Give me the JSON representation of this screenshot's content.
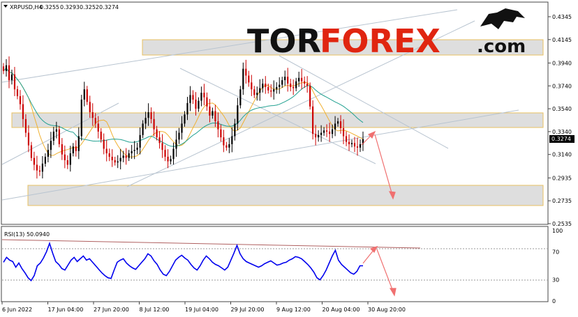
{
  "chart_data": [
    {
      "type": "candlestick",
      "symbol": "XRPUSD,H4",
      "ohlc": [
        "0.3255",
        "0.3293",
        "0.3252",
        "0.3274"
      ],
      "current_price": "0.3274",
      "price_ticks": [
        "0.4345",
        "0.4145",
        "0.3940",
        "0.3740",
        "0.3540",
        "0.3340",
        "0.3140",
        "0.2935",
        "0.2735",
        "0.2535"
      ],
      "ylim": [
        0.2535,
        0.4345
      ],
      "x_ticks": [
        "6 Jun 2022",
        "17 Jun 04:00",
        "27 Jun 20:00",
        "8 Jul 12:00",
        "19 Jul 04:00",
        "29 Jul 20:00",
        "9 Aug 12:00",
        "20 Aug 04:00",
        "30 Aug 20:00"
      ],
      "close_series": [
        0.387,
        0.392,
        0.379,
        0.384,
        0.371,
        0.365,
        0.358,
        0.345,
        0.333,
        0.322,
        0.311,
        0.305,
        0.3,
        0.299,
        0.306,
        0.312,
        0.318,
        0.326,
        0.334,
        0.336,
        0.323,
        0.314,
        0.309,
        0.305,
        0.315,
        0.321,
        0.317,
        0.33,
        0.362,
        0.371,
        0.36,
        0.351,
        0.346,
        0.341,
        0.334,
        0.327,
        0.319,
        0.315,
        0.312,
        0.309,
        0.307,
        0.308,
        0.311,
        0.313,
        0.311,
        0.315,
        0.317,
        0.318,
        0.32,
        0.331,
        0.341,
        0.346,
        0.351,
        0.345,
        0.336,
        0.329,
        0.324,
        0.318,
        0.312,
        0.308,
        0.31,
        0.319,
        0.327,
        0.333,
        0.341,
        0.349,
        0.359,
        0.366,
        0.362,
        0.354,
        0.361,
        0.368,
        0.364,
        0.356,
        0.348,
        0.352,
        0.343,
        0.336,
        0.329,
        0.322,
        0.32,
        0.323,
        0.33,
        0.341,
        0.357,
        0.371,
        0.389,
        0.383,
        0.377,
        0.371,
        0.366,
        0.368,
        0.372,
        0.376,
        0.373,
        0.37,
        0.369,
        0.371,
        0.373,
        0.375,
        0.379,
        0.382,
        0.376,
        0.373,
        0.372,
        0.378,
        0.381,
        0.378,
        0.376,
        0.374,
        0.356,
        0.332,
        0.329,
        0.331,
        0.333,
        0.335,
        0.334,
        0.332,
        0.336,
        0.341,
        0.343,
        0.337,
        0.33,
        0.325,
        0.323,
        0.324,
        0.321,
        0.32,
        0.323,
        0.3274
      ],
      "rsi": {
        "label": "RSI(13) 50.0940",
        "ticks": [
          "100",
          "70",
          "30",
          "0"
        ],
        "levels": [
          70,
          30
        ],
        "series": [
          55,
          62,
          58,
          56,
          48,
          54,
          46,
          40,
          33,
          29,
          36,
          50,
          54,
          61,
          70,
          82,
          68,
          56,
          52,
          46,
          44,
          51,
          58,
          62,
          56,
          60,
          64,
          58,
          60,
          55,
          50,
          45,
          40,
          36,
          33,
          32,
          44,
          55,
          58,
          60,
          54,
          50,
          47,
          45,
          50,
          55,
          60,
          67,
          64,
          57,
          52,
          44,
          38,
          36,
          42,
          50,
          58,
          62,
          65,
          61,
          58,
          52,
          47,
          44,
          50,
          58,
          64,
          60,
          55,
          52,
          50,
          47,
          44,
          48,
          58,
          68,
          79,
          67,
          60,
          56,
          54,
          52,
          50,
          48,
          50,
          53,
          55,
          57,
          54,
          51,
          52,
          54,
          55,
          58,
          60,
          63,
          62,
          60,
          56,
          52,
          47,
          41,
          33,
          30,
          36,
          44,
          54,
          64,
          72,
          58,
          52,
          48,
          44,
          40,
          38,
          42,
          50,
          50.094
        ]
      }
    }
  ],
  "branding": {
    "word_tor": "TOR",
    "word_forex": "FOREX",
    "word_com": ".com"
  },
  "colors": {
    "bull_candle": "#000000",
    "bear_candle": "#cc0000",
    "ma_fast": "#f0b030",
    "ma_slow": "#20a090",
    "rsi_line": "#0000ee",
    "zone_fill": "#dedede",
    "zone_border": "#e8c060",
    "forecast_arrow": "#f07070",
    "trendlines": "#b8c4d0",
    "forex_red": "#e02510"
  }
}
